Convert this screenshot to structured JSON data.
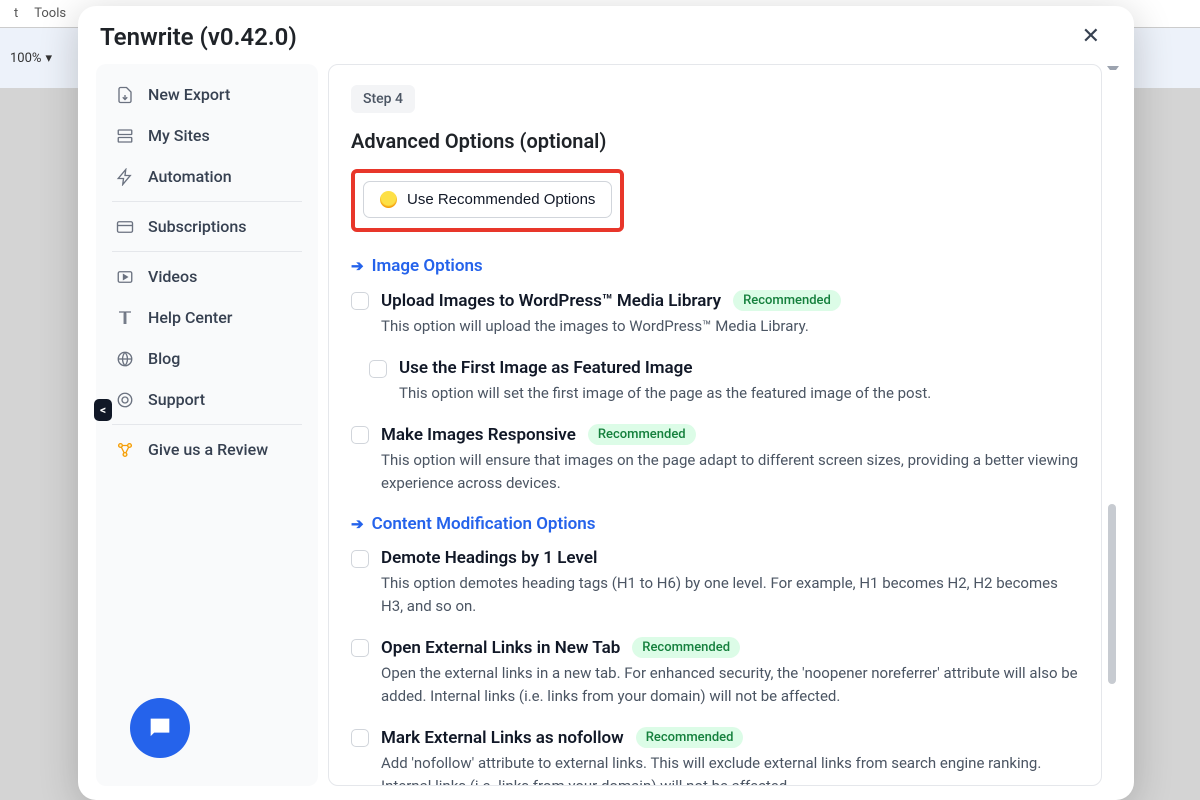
{
  "bg": {
    "menu1": "t",
    "menu2": "Tools",
    "zoom": "100%"
  },
  "modal": {
    "title": "Tenwrite (v0.42.0)"
  },
  "collapse_label": "<",
  "sidebar": {
    "items": [
      {
        "label": "New Export"
      },
      {
        "label": "My Sites"
      },
      {
        "label": "Automation"
      },
      {
        "label": "Subscriptions"
      },
      {
        "label": "Videos"
      },
      {
        "label": "Help Center"
      },
      {
        "label": "Blog"
      },
      {
        "label": "Support"
      },
      {
        "label": "Give us a Review"
      }
    ]
  },
  "main": {
    "step_badge": "Step 4",
    "heading": "Advanced Options (optional)",
    "recommend_button": "Use Recommended Options",
    "sections": {
      "image": {
        "title": "Image Options",
        "opts": [
          {
            "chk": false,
            "title": "Upload Images to WordPress™ Media Library",
            "badge": "Recommended",
            "desc": "This option will upload the images to WordPress™ Media Library."
          },
          {
            "chk": false,
            "title": "Use the First Image as Featured Image",
            "desc": "This option will set the first image of the page as the featured image of the post.",
            "indent": true
          },
          {
            "chk": false,
            "title": "Make Images Responsive",
            "badge": "Recommended",
            "desc": "This option will ensure that images on the page adapt to different screen sizes, providing a better viewing experience across devices."
          }
        ]
      },
      "content": {
        "title": "Content Modification Options",
        "opts": [
          {
            "chk": false,
            "title": "Demote Headings by 1 Level",
            "desc": "This option demotes heading tags (H1 to H6) by one level. For example, H1 becomes H2, H2 becomes H3, and so on."
          },
          {
            "chk": false,
            "title": "Open External Links in New Tab",
            "badge": "Recommended",
            "desc": "Open the external links in a new tab. For enhanced security, the 'noopener noreferrer' attribute will also be added. Internal links (i.e. links from your domain) will not be affected."
          },
          {
            "chk": false,
            "title": "Mark External Links as nofollow",
            "badge": "Recommended",
            "desc": "Add 'nofollow' attribute to external links. This will exclude external links from search engine ranking. Internal links (i.e. links from your domain) will not be affected."
          }
        ]
      }
    }
  }
}
